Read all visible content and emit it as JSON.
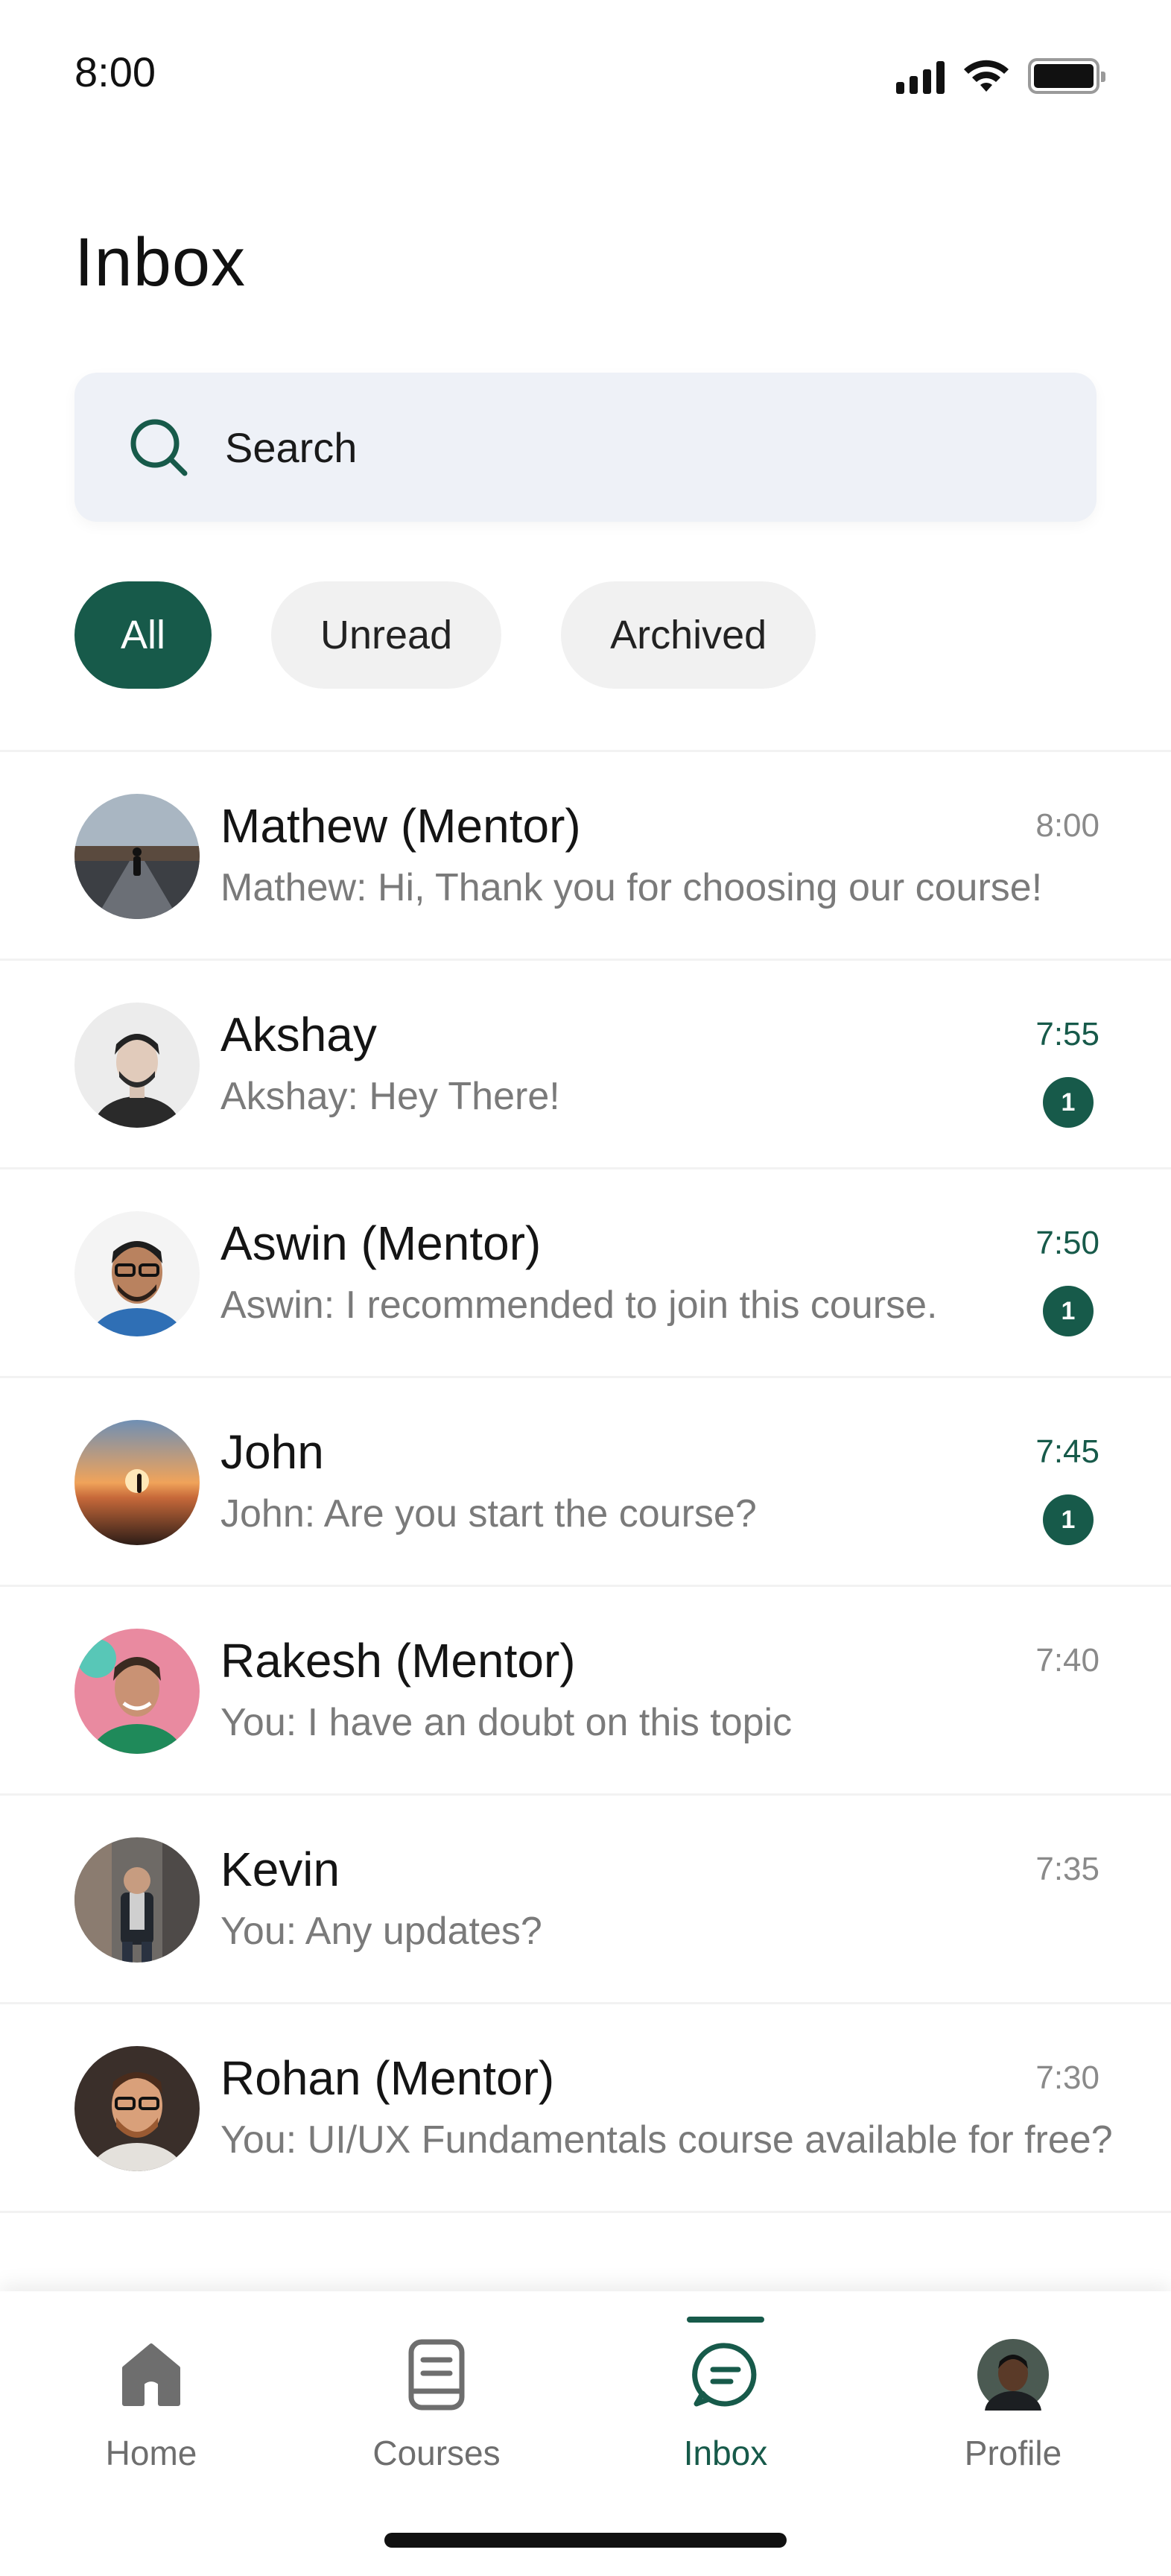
{
  "status_bar": {
    "time": "8:00"
  },
  "header": {
    "title": "Inbox"
  },
  "search": {
    "placeholder": "Search"
  },
  "filters": {
    "all": "All",
    "unread": "Unread",
    "archived": "Archived"
  },
  "chats": [
    {
      "name": "Mathew (Mentor)",
      "preview": "Mathew: Hi, Thank you for choosing our course!",
      "time": "8:00"
    },
    {
      "name": "Akshay",
      "preview": "Akshay: Hey There!",
      "time": "7:55",
      "unread_count": "1"
    },
    {
      "name": "Aswin (Mentor)",
      "preview": "Aswin: I recommended to join this course.",
      "time": "7:50",
      "unread_count": "1"
    },
    {
      "name": "John",
      "preview": "John: Are you start the course?",
      "time": "7:45",
      "unread_count": "1"
    },
    {
      "name": "Rakesh (Mentor)",
      "preview": "You: I have an doubt on this topic",
      "time": "7:40"
    },
    {
      "name": "Kevin",
      "preview": "You: Any updates?",
      "time": "7:35"
    },
    {
      "name": "Rohan (Mentor)",
      "preview": "You: UI/UX Fundamentals course available for free?",
      "time": "7:30"
    }
  ],
  "bottom_nav": {
    "home": "Home",
    "courses": "Courses",
    "inbox": "Inbox",
    "profile": "Profile"
  },
  "colors": {
    "accent": "#175a4a",
    "search_bg": "#eef1f7",
    "chip_bg": "#f1f1f1",
    "muted_text": "#7a7a7a"
  },
  "icons": {
    "search": "search-icon",
    "home": "home-icon",
    "courses": "book-icon",
    "inbox": "chat-bubble-icon",
    "signal": "signal-icon",
    "wifi": "wifi-icon",
    "battery": "battery-icon"
  }
}
